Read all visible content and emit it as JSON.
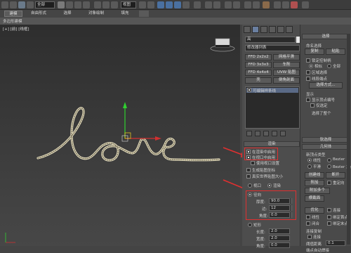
{
  "toolbar": {
    "selection_filter": "全部",
    "view_dropdown": "视图",
    "colors": {
      "accent": "#4a90d9",
      "red": "#d84a4a",
      "green": "#4ab04a",
      "yellow": "#e0c040"
    }
  },
  "ribbon": {
    "tabs": [
      "建模",
      "自由形式",
      "选择",
      "对象绘制",
      "填充"
    ],
    "sub_label": "多边形建模"
  },
  "viewport": {
    "label": "[+] [前] [线框]",
    "spline_text": "love"
  },
  "command_panel": {
    "object_name": "高",
    "modifier_list": "修改器列表",
    "mod_buttons": [
      [
        "FFD 2x2x2",
        "网格平滑"
      ],
      [
        "FFD 3x3x3",
        "车削"
      ],
      [
        "FFD 4x4x4",
        "UVW 贴图"
      ],
      [
        "壳",
        "倒角剖面"
      ]
    ],
    "stack_item": "可编辑样条线",
    "rendering": {
      "header": "渲染",
      "enable_in_render": "在渲染中启用",
      "enable_in_viewport": "在视口中启用",
      "use_viewport_settings": "使用视口设置",
      "generate_mapping": "生成贴图坐标",
      "real_world_map": "真实世界贴图大小",
      "viewport_radio": "视口",
      "render_radio": "渲染",
      "radial_label": "径向",
      "thickness_label": "厚度:",
      "thickness_value": "90.0",
      "sides_label": "边:",
      "sides_value": "12",
      "angle_label": "角度:",
      "angle_value": "0.0",
      "rect_label": "矩形",
      "length_label": "长度:",
      "length_value": "2.0",
      "width_label": "宽度:",
      "width_value": "2.0",
      "rect_angle_label": "角度:",
      "rect_angle_value": "0.0"
    }
  },
  "right_panel": {
    "selection_header": "选择",
    "named_sel_header": "命名选择",
    "copy_btn": "复制",
    "paste_btn": "粘贴",
    "lock_handles": "锁定控制柄",
    "similar": "相似",
    "all": "全部",
    "area_select": "区域选择",
    "segment_end": "线段端点",
    "select_by": "选择方式...",
    "display_header": "显示",
    "show_vertex_numbers": "显示顶点编号",
    "only_selected": "仅选定",
    "selected_count": "选择了整个",
    "soft_selection_header": "软选择",
    "geometry_header": "几何体",
    "new_vertex_type": "新顶点类型",
    "linear": "线性",
    "bezier": "Bezier",
    "smooth": "平滑",
    "bezier_corner": "Bezier 角点",
    "create_line": "创建线",
    "break": "断开",
    "attach": "附加",
    "reorient": "重定向",
    "attach_multiple": "附加多个",
    "cross_section": "横截面",
    "optimize": "优化",
    "connect": "连接",
    "linear2": "线性",
    "bind_first": "绑定首点",
    "closed": "闭合",
    "bind_last": "绑定末点",
    "connect_copy_header": "连接复制",
    "connect_chk": "连接",
    "threshold_label": "阈值距离",
    "threshold_value": "0.1",
    "end_auto_weld": "端点自动焊接"
  }
}
